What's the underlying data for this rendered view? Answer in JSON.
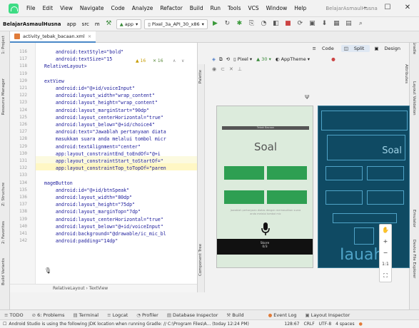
{
  "menubar": {
    "items": [
      {
        "label": "File"
      },
      {
        "label": "Edit"
      },
      {
        "label": "View"
      },
      {
        "label": "Navigate"
      },
      {
        "label": "Code"
      },
      {
        "label": "Analyze"
      },
      {
        "label": "Refactor"
      },
      {
        "label": "Build"
      },
      {
        "label": "Run"
      },
      {
        "label": "Tools"
      },
      {
        "label": "VCS"
      },
      {
        "label": "Window"
      },
      {
        "label": "Help"
      }
    ],
    "window_title": "BelajarAsmaulHusna"
  },
  "toolbar": {
    "project": "BelajarAsmaulHusna",
    "crumbs": [
      "app",
      "src",
      "m"
    ],
    "run_config": "app",
    "device": "Pixel_3a_API_30_x86"
  },
  "file_tab": {
    "label": "activity_tebak_bacaan.xml"
  },
  "left_strip": {
    "project": "1: Project",
    "resource_manager": "Resource Manager",
    "structure": "Z: Structure",
    "favorites": "2: Favorites",
    "build_variants": "Build Variants"
  },
  "right_strip": {
    "gradle": "Gradle",
    "layout_validation": "Layout Validation",
    "emulator": "Emulator",
    "device_file_explorer": "Device File Explorer"
  },
  "editor": {
    "warnings": "▲ 16",
    "errors": "✕ 16",
    "lines": [
      {
        "n": "116",
        "text": "    android:textStyle=\"bold\""
      },
      {
        "n": "117",
        "text": "    android:textSize=\"15"
      },
      {
        "n": "118",
        "text": "RelativeLayout>"
      },
      {
        "n": "119",
        "text": ""
      },
      {
        "n": "120",
        "text": "extView"
      },
      {
        "n": "121",
        "text": "    android:id=\"@+id/voiceInput\""
      },
      {
        "n": "122",
        "text": "    android:layout_width=\"wrap_content\""
      },
      {
        "n": "123",
        "text": "    android:layout_height=\"wrap_content\""
      },
      {
        "n": "124",
        "text": "    android:layout_marginStart=\"90dp\""
      },
      {
        "n": "125",
        "text": "    android:layout_centerHorizontal=\"true\""
      },
      {
        "n": "126",
        "text": "    android:layout_below=\"@+id/choice4\""
      },
      {
        "n": "127",
        "text": "    android:text=\"Jawablah pertanyaan diata"
      },
      {
        "n": "128",
        "text": "    masukkan suara anda melalui tombol micr"
      },
      {
        "n": "129",
        "text": "    android:textAlignment=\"center\""
      },
      {
        "n": "130",
        "text": "    app:layout_constraintEnd_toEndOf=\"@+i"
      },
      {
        "n": "131",
        "text": "    app:layout_constraintStart_toStartOf=\""
      },
      {
        "n": "132",
        "text": "    app:layout_constraintTop_toTopOf=\"paren"
      },
      {
        "n": "133",
        "text": ""
      },
      {
        "n": "134",
        "text": "mageButton"
      },
      {
        "n": "135",
        "text": "    android:id=\"@+id/btnSpeak\""
      },
      {
        "n": "136",
        "text": "    android:layout_width=\"80dp\""
      },
      {
        "n": "137",
        "text": "    android:layout_height=\"75dp\""
      },
      {
        "n": "138",
        "text": "    android:layout_marginTop=\"7dp\""
      },
      {
        "n": "139",
        "text": "    android:layout_centerHorizontal=\"true\""
      },
      {
        "n": "140",
        "text": "    android:layout_below=\"@+id/voiceInput\""
      },
      {
        "n": "141",
        "text": "    android:background=\"@drawable/ic_mic_bl"
      },
      {
        "n": "142",
        "text": "    android:padding=\"14dp\""
      }
    ],
    "breadcrumb": "RelativeLayout  ›  TextView"
  },
  "design": {
    "modes": [
      "Code",
      "Split",
      "Design"
    ],
    "active_mode": "Split",
    "device": "Pixel",
    "api": "30",
    "theme": "AppTheme",
    "palette_label": "Palette",
    "component_tree_label": "Component Tree",
    "attributes_label": "Attributes",
    "phone": {
      "topbar": "Tebak Bacaan",
      "title": "Soal",
      "choices": [
        "",
        "",
        "",
        ""
      ],
      "hint": "Jawablah pertanyaan diatas dengan memasukkan suara anda melalui tombol mic",
      "bottom_label": "Skore",
      "bottom_value": "0/3"
    },
    "blueprint_title": "Soal"
  },
  "toolwindows": [
    {
      "icon": "≡",
      "label": "TODO"
    },
    {
      "icon": "⊘",
      "label": "6: Problems"
    },
    {
      "icon": "▤",
      "label": "Terminal"
    },
    {
      "icon": "≡",
      "label": "Logcat"
    },
    {
      "icon": "◔",
      "label": "Profiler"
    },
    {
      "icon": "▤",
      "label": "Database Inspector"
    },
    {
      "icon": "⚒",
      "label": "Build"
    },
    {
      "icon": "●",
      "label": "Event Log"
    },
    {
      "icon": "▣",
      "label": "Layout Inspector"
    }
  ],
  "statusbar": {
    "message": "Android Studio is using the following JDK location when running Gradle: // C:\\Program Files\\A... (today 12:24 PM)",
    "position": "128:67",
    "line_sep": "CRLF",
    "encoding": "UTF-8",
    "indent": "4 spaces"
  }
}
